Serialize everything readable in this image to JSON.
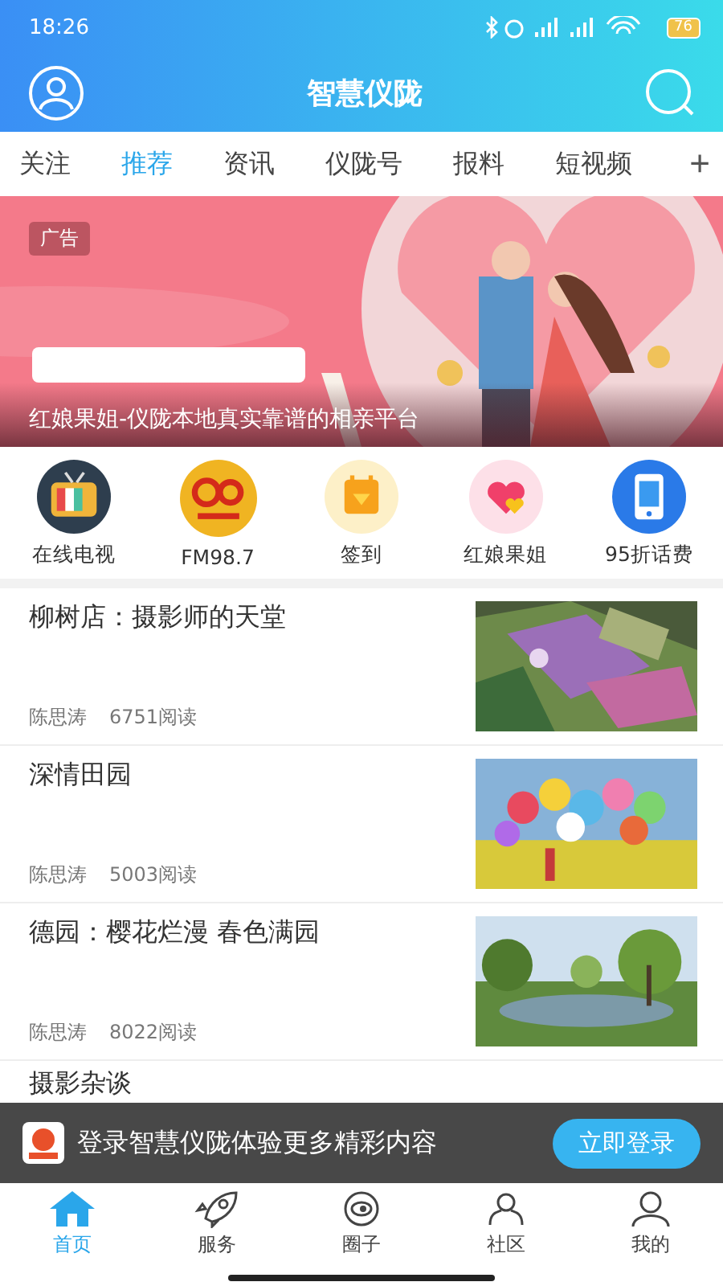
{
  "status_bar": {
    "time": "18:26",
    "battery": "76"
  },
  "header": {
    "title": "智慧仪陇"
  },
  "tabs": [
    {
      "label": "关注",
      "selected": false
    },
    {
      "label": "推荐",
      "selected": true
    },
    {
      "label": "资讯",
      "selected": false
    },
    {
      "label": "仪陇号",
      "selected": false
    },
    {
      "label": "报料",
      "selected": false
    },
    {
      "label": "短视频",
      "selected": false
    }
  ],
  "tab_add": "+",
  "banner": {
    "badge": "广告",
    "caption": "红娘果姐-仪陇本地真实靠谱的相亲平台"
  },
  "shortcuts": [
    {
      "label": "在线电视"
    },
    {
      "label": "FM98.7"
    },
    {
      "label": "签到"
    },
    {
      "label": "红娘果姐"
    },
    {
      "label": "95折话费"
    }
  ],
  "articles": [
    {
      "title": "柳树店：摄影师的天堂",
      "author": "陈思涛",
      "reads": "6751阅读"
    },
    {
      "title": "深情田园",
      "author": "陈思涛",
      "reads": "5003阅读"
    },
    {
      "title": "德园：樱花烂漫  春色满园",
      "author": "陈思涛",
      "reads": "8022阅读"
    },
    {
      "title": "摄影杂谈"
    }
  ],
  "login_bar": {
    "text": "登录智慧仪陇体验更多精彩内容",
    "button": "立即登录"
  },
  "bottom_nav": [
    {
      "label": "首页",
      "selected": true
    },
    {
      "label": "服务",
      "selected": false
    },
    {
      "label": "圈子",
      "selected": false
    },
    {
      "label": "社区",
      "selected": false
    },
    {
      "label": "我的",
      "selected": false
    }
  ]
}
